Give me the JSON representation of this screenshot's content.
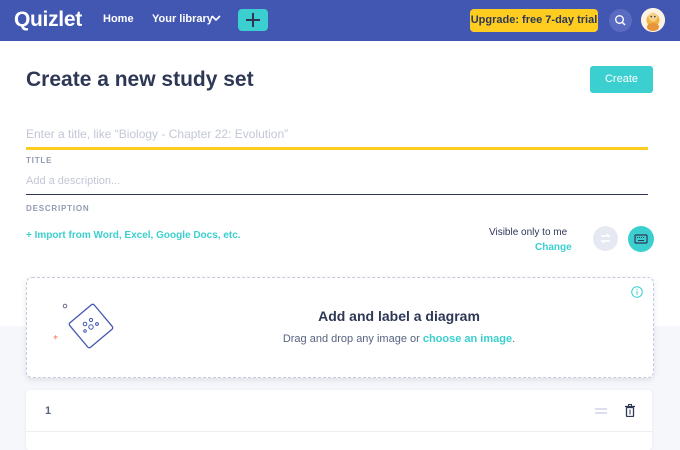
{
  "header": {
    "logo": "Quizlet",
    "nav_home": "Home",
    "nav_library": "Your library",
    "upgrade_label": "Upgrade: free 7-day trial"
  },
  "page": {
    "title": "Create a new study set",
    "create_label": "Create"
  },
  "form": {
    "title_placeholder": "Enter a title, like “Biology - Chapter 22: Evolution”",
    "title_label": "TITLE",
    "description_placeholder": "Add a description...",
    "description_label": "DESCRIPTION",
    "import_link": "+ Import from Word, Excel, Google Docs, etc.",
    "visibility_text": "Visible only to me",
    "change_link": "Change"
  },
  "diagram": {
    "title": "Add and label a diagram",
    "subtitle_prefix": "Drag and drop any image or ",
    "choose_link": "choose an image",
    "subtitle_suffix": "."
  },
  "terms": [
    {
      "number": "1"
    }
  ],
  "colors": {
    "header_bg": "#4257b2",
    "accent_teal": "#3ccfcf",
    "upgrade_yellow": "#ffcd1f",
    "text_dark": "#2e3856"
  },
  "icons": {
    "plus": "plus-icon",
    "chevron": "chevron-down-icon",
    "search": "search-icon",
    "swap": "swap-icon",
    "keyboard": "keyboard-icon",
    "info": "info-icon",
    "drag": "drag-handle-icon",
    "trash": "trash-icon"
  }
}
